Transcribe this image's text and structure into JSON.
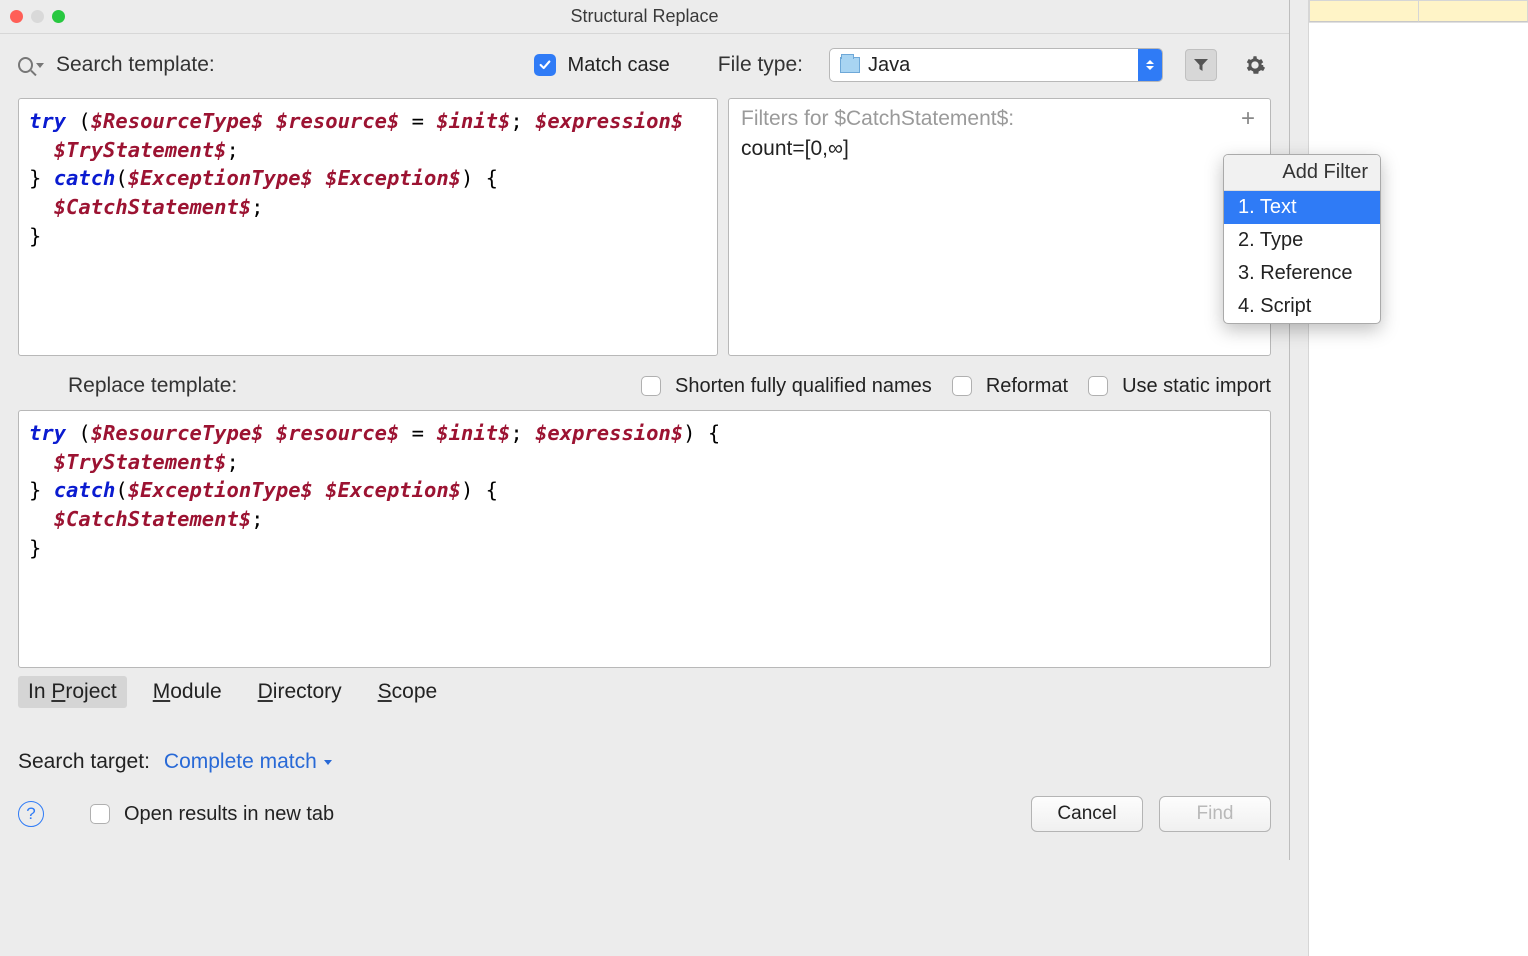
{
  "window_title": "Structural Replace",
  "search_template_label": "Search template:",
  "match_case_label": "Match case",
  "match_case_checked": true,
  "file_type_label": "File type:",
  "file_type_value": "Java",
  "filter_header": "Filters for $CatchStatement$:",
  "filter_count": "count=[0,∞]",
  "add_filter_title": "Add Filter",
  "add_filter_options": [
    "1. Text",
    "2. Type",
    "3. Reference",
    "4. Script"
  ],
  "replace_template_label": "Replace template:",
  "shorten_label": "Shorten fully qualified names",
  "reformat_label": "Reformat",
  "static_import_label": "Use static import",
  "scopes": [
    "In Project",
    "Module",
    "Directory",
    "Scope"
  ],
  "scope_ul_index": [
    3,
    0,
    0,
    0
  ],
  "search_target_label": "Search target:",
  "search_target_value": "Complete match",
  "open_new_tab_label": "Open results in new tab",
  "cancel_label": "Cancel",
  "find_label": "Find",
  "code1": [
    {
      "t": "kw",
      "s": "try"
    },
    {
      "t": "pl",
      "s": " ("
    },
    {
      "t": "v",
      "s": "$ResourceType$"
    },
    {
      "t": "pl",
      "s": " "
    },
    {
      "t": "v",
      "s": "$resource$"
    },
    {
      "t": "pl",
      "s": " = "
    },
    {
      "t": "v",
      "s": "$init$"
    },
    {
      "t": "pl",
      "s": "; "
    },
    {
      "t": "v",
      "s": "$expression$"
    },
    {
      "t": "nl"
    },
    {
      "t": "pl",
      "s": "  "
    },
    {
      "t": "v",
      "s": "$TryStatement$"
    },
    {
      "t": "pl",
      "s": ";"
    },
    {
      "t": "nl"
    },
    {
      "t": "pl",
      "s": "} "
    },
    {
      "t": "kw",
      "s": "catch"
    },
    {
      "t": "pl",
      "s": "("
    },
    {
      "t": "v",
      "s": "$ExceptionType$"
    },
    {
      "t": "pl",
      "s": " "
    },
    {
      "t": "v",
      "s": "$Exception$"
    },
    {
      "t": "pl",
      "s": ") {"
    },
    {
      "t": "nl"
    },
    {
      "t": "pl",
      "s": "  "
    },
    {
      "t": "v",
      "s": "$CatchStatement$"
    },
    {
      "t": "pl",
      "s": ";"
    },
    {
      "t": "nl"
    },
    {
      "t": "pl",
      "s": "}"
    }
  ],
  "code2": [
    {
      "t": "kw",
      "s": "try"
    },
    {
      "t": "pl",
      "s": " ("
    },
    {
      "t": "v",
      "s": "$ResourceType$"
    },
    {
      "t": "pl",
      "s": " "
    },
    {
      "t": "v",
      "s": "$resource$"
    },
    {
      "t": "pl",
      "s": " = "
    },
    {
      "t": "v",
      "s": "$init$"
    },
    {
      "t": "pl",
      "s": "; "
    },
    {
      "t": "v",
      "s": "$expression$"
    },
    {
      "t": "pl",
      "s": ") {"
    },
    {
      "t": "nl"
    },
    {
      "t": "pl",
      "s": "  "
    },
    {
      "t": "v",
      "s": "$TryStatement$"
    },
    {
      "t": "pl",
      "s": ";"
    },
    {
      "t": "nl"
    },
    {
      "t": "pl",
      "s": "} "
    },
    {
      "t": "kw",
      "s": "catch"
    },
    {
      "t": "pl",
      "s": "("
    },
    {
      "t": "v",
      "s": "$ExceptionType$"
    },
    {
      "t": "pl",
      "s": " "
    },
    {
      "t": "v",
      "s": "$Exception$"
    },
    {
      "t": "pl",
      "s": ") {"
    },
    {
      "t": "nl"
    },
    {
      "t": "pl",
      "s": "  "
    },
    {
      "t": "v",
      "s": "$CatchStatement$"
    },
    {
      "t": "pl",
      "s": ";"
    },
    {
      "t": "nl"
    },
    {
      "t": "pl",
      "s": "}"
    }
  ]
}
